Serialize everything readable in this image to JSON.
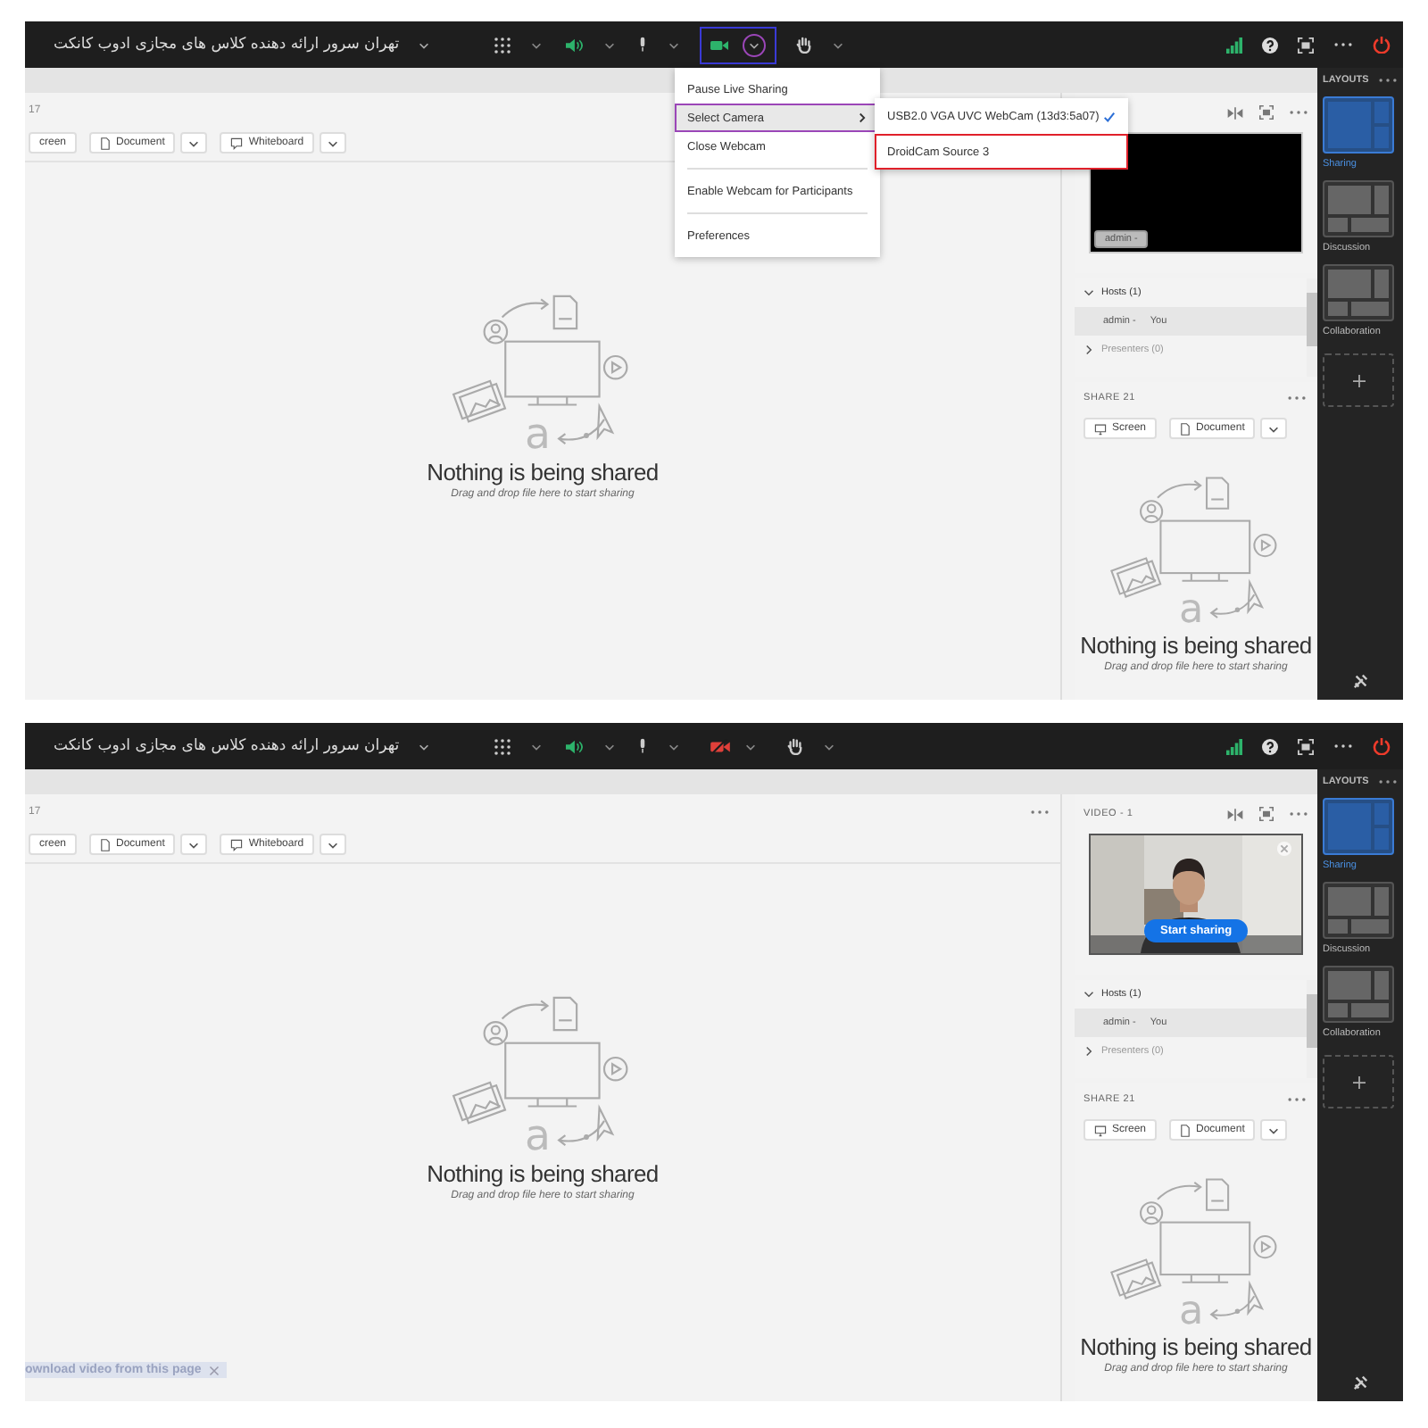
{
  "screens": [
    {
      "toolbar": {
        "title": "تهران سرور ارائه دهنده کلاس های مجازی ادوب کانکت",
        "camera": {
          "on": true,
          "color": "#3a3ad6",
          "menu_button": {
            "color": "#9b46b8"
          }
        }
      },
      "camera_menu": {
        "items": [
          {
            "label": "Pause Live Sharing",
            "kind": "item",
            "selected": false
          },
          {
            "label": "Select Camera",
            "kind": "submenu",
            "selected": true,
            "color": "#9b46b8"
          },
          {
            "label": "Close Webcam",
            "kind": "item",
            "selected": false
          },
          {
            "label": "Enable Webcam for Participants",
            "kind": "item",
            "selected": false
          },
          {
            "label": "Preferences",
            "kind": "item",
            "selected": false
          }
        ],
        "submenu": [
          {
            "label": "USB2.0 VGA UVC WebCam (13d3:5a07)",
            "checked": true
          },
          {
            "label": "DroidCam Source 3",
            "checked": false,
            "color": "#e0202a"
          }
        ]
      },
      "main_pod": {
        "header": "17",
        "buttons": [
          {
            "label": "creen",
            "kind": "plain",
            "dropdown": false
          },
          {
            "label": "Document",
            "kind": "document",
            "dropdown": true
          },
          {
            "label": "Whiteboard",
            "kind": "whiteboard",
            "dropdown": true
          }
        ],
        "glyph": "a",
        "empty_title": "Nothing is being shared",
        "empty_hint": "Drag and drop file here to start sharing"
      },
      "video_pod": {
        "kind": "blank",
        "name_tag": "admin -"
      },
      "attendees": [
        {
          "label": "Hosts (1)",
          "expanded": true,
          "members": [
            {
              "name": "admin -",
              "role": "You"
            }
          ]
        },
        {
          "label": "Presenters (0)",
          "expanded": false
        }
      ],
      "share_pod": {
        "title": "SHARE 21",
        "buttons": [
          {
            "label": "Screen",
            "kind": "screen",
            "dropdown": false
          },
          {
            "label": "Document",
            "kind": "document",
            "dropdown": true
          }
        ],
        "glyph": "a",
        "empty_title": "Nothing is being shared",
        "empty_hint": "Drag and drop file here to start sharing"
      },
      "layouts": {
        "title": "LAYOUTS",
        "items": [
          {
            "label": "Sharing",
            "selected": true
          },
          {
            "label": "Discussion",
            "selected": false
          },
          {
            "label": "Collaboration",
            "selected": false
          }
        ]
      }
    },
    {
      "toolbar": {
        "title": "تهران سرور ارائه دهنده کلاس های مجازی ادوب کانکت",
        "camera": {
          "on": false
        }
      },
      "main_pod": {
        "header": "17",
        "more_button": true,
        "buttons": [
          {
            "label": "creen",
            "kind": "plain",
            "dropdown": false
          },
          {
            "label": "Document",
            "kind": "document",
            "dropdown": true
          },
          {
            "label": "Whiteboard",
            "kind": "whiteboard",
            "dropdown": true
          }
        ],
        "glyph": "a",
        "empty_title": "Nothing is being shared",
        "empty_hint": "Drag and drop file here to start sharing",
        "overlay_text": "ownload video from this page"
      },
      "video_pod": {
        "title": "VIDEO - 1",
        "kind": "picture",
        "action": "Start sharing"
      },
      "attendees": [
        {
          "label": "Hosts (1)",
          "expanded": true,
          "members": [
            {
              "name": "admin -",
              "role": "You"
            }
          ]
        },
        {
          "label": "Presenters (0)",
          "expanded": false
        }
      ],
      "share_pod": {
        "title": "SHARE 21",
        "buttons": [
          {
            "label": "Screen",
            "kind": "screen",
            "dropdown": false
          },
          {
            "label": "Document",
            "kind": "document",
            "dropdown": true
          }
        ],
        "glyph": "a",
        "empty_title": "Nothing is being shared",
        "empty_hint": "Drag and drop file here to start sharing"
      },
      "layouts": {
        "title": "LAYOUTS",
        "items": [
          {
            "label": "Sharing",
            "selected": true
          },
          {
            "label": "Discussion",
            "selected": false
          },
          {
            "label": "Collaboration",
            "selected": false
          }
        ]
      }
    }
  ]
}
